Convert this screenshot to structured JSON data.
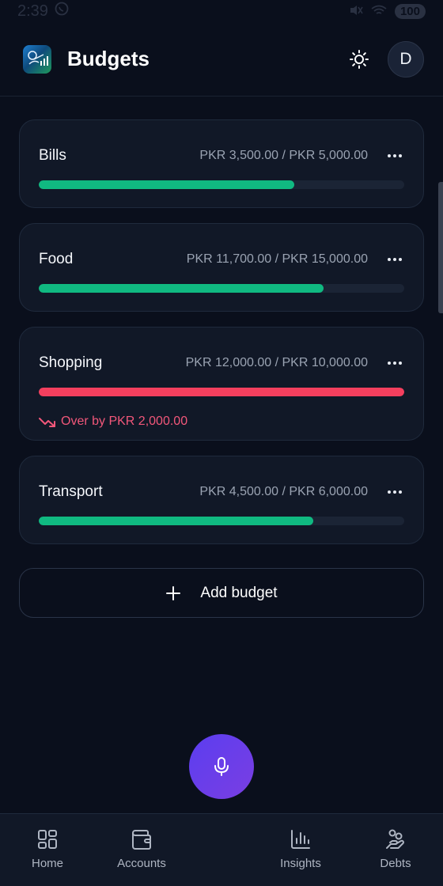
{
  "status_bar": {
    "time": "2:39",
    "battery": "100"
  },
  "header": {
    "title": "Budgets",
    "avatar_initial": "D"
  },
  "colors": {
    "ok": "#10b981",
    "over": "#f43f5e",
    "accent": "#5b3df0"
  },
  "budgets": [
    {
      "name": "Bills",
      "amount": "PKR 3,500.00 / PKR 5,000.00",
      "progress": 0.7,
      "status": "ok"
    },
    {
      "name": "Food",
      "amount": "PKR 11,700.00 / PKR 15,000.00",
      "progress": 0.78,
      "status": "ok"
    },
    {
      "name": "Shopping",
      "amount": "PKR 12,000.00 / PKR 10,000.00",
      "progress": 1.0,
      "status": "over",
      "note": "Over by PKR 2,000.00"
    },
    {
      "name": "Transport",
      "amount": "PKR 4,500.00 / PKR 6,000.00",
      "progress": 0.75,
      "status": "ok"
    }
  ],
  "add_budget_label": "Add budget",
  "nav": [
    {
      "label": "Home",
      "icon": "grid-icon"
    },
    {
      "label": "Accounts",
      "icon": "wallet-icon"
    },
    {
      "label": "Insights",
      "icon": "bar-chart-icon"
    },
    {
      "label": "Debts",
      "icon": "hand-coins-icon"
    }
  ]
}
